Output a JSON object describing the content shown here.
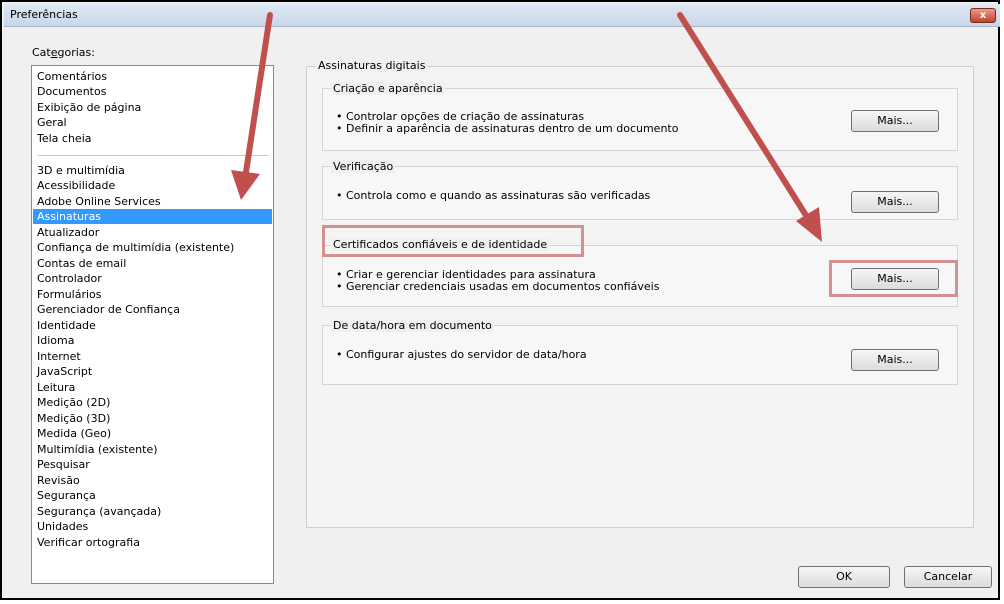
{
  "window": {
    "title": "Preferências",
    "close_label": "x"
  },
  "categories": {
    "label_prefix": "Cat",
    "label_underlined": "e",
    "label_suffix": "gorias:",
    "group1": [
      "Comentários",
      "Documentos",
      "Exibição de página",
      "Geral",
      "Tela cheia"
    ],
    "group2": [
      "3D e multimídia",
      "Acessibilidade",
      "Adobe Online Services",
      "Assinaturas",
      "Atualizador",
      "Confiança de multimídia (existente)",
      "Contas de email",
      "Controlador",
      "Formulários",
      "Gerenciador de Confiança",
      "Identidade",
      "Idioma",
      "Internet",
      "JavaScript",
      "Leitura",
      "Medição (2D)",
      "Medição (3D)",
      "Medida (Geo)",
      "Multimídia (existente)",
      "Pesquisar",
      "Revisão",
      "Segurança",
      "Segurança (avançada)",
      "Unidades",
      "Verificar ortografia"
    ],
    "selected": "Assinaturas"
  },
  "panel": {
    "title": "Assinaturas digitais",
    "sections": [
      {
        "title": "Criação e aparência",
        "bullets": [
          "• Controlar opções de criação de assinaturas",
          "• Definir a aparência de assinaturas dentro de um documento"
        ],
        "button": "Mais..."
      },
      {
        "title": "Verificação",
        "bullets": [
          "• Controla como e quando as assinaturas são verificadas"
        ],
        "button": "Mais..."
      },
      {
        "title": "Certificados confiáveis e de identidade",
        "bullets": [
          "• Criar e gerenciar identidades para assinatura",
          "• Gerenciar credenciais usadas em documentos confiáveis"
        ],
        "button": "Mais..."
      },
      {
        "title": "De data/hora em documento",
        "bullets": [
          "• Configurar ajustes do servidor de data/hora"
        ],
        "button": "Mais..."
      }
    ]
  },
  "footer": {
    "ok": "OK",
    "cancel": "Cancelar"
  },
  "colors": {
    "selection": "#3399ff",
    "annotation": "#c0504d",
    "highlight_box": "#d49191"
  }
}
